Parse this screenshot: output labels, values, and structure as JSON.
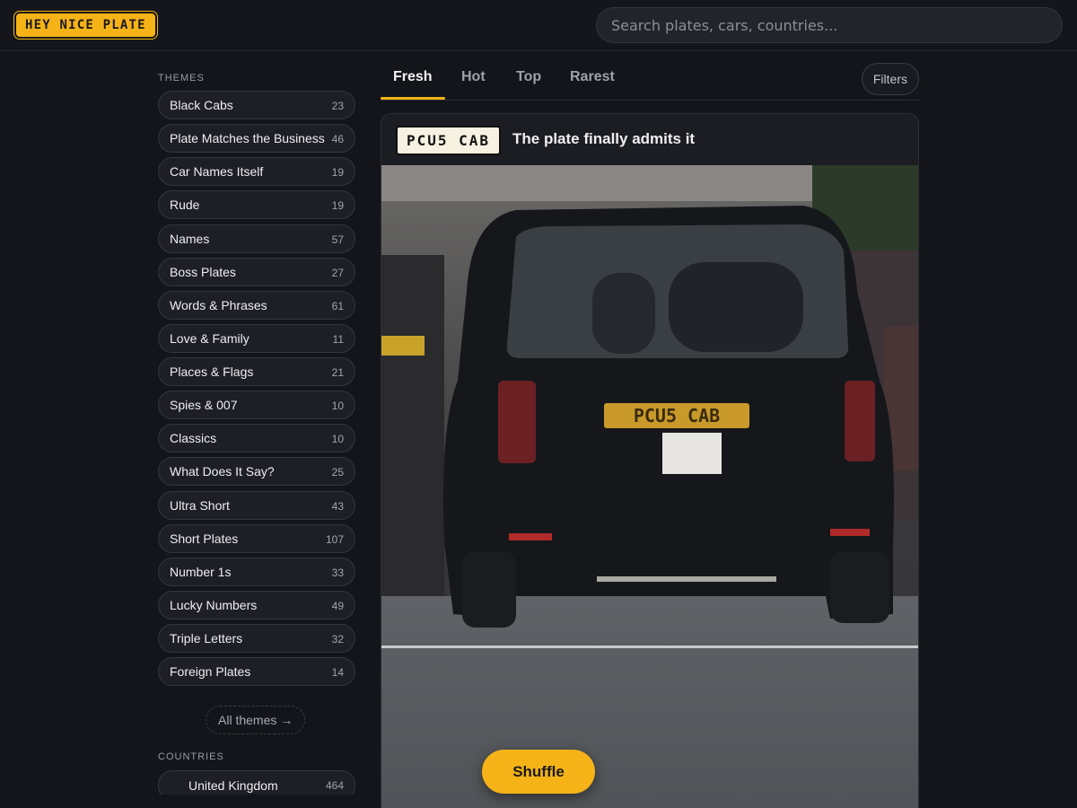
{
  "header": {
    "logo_text": "HEY NICE PLATE",
    "search_placeholder": "Search plates, cars, countries...",
    "accent_color": "#f5b318"
  },
  "sidebar": {
    "themes_title": "THEMES",
    "themes": [
      {
        "label": "Black Cabs",
        "count": "23"
      },
      {
        "label": "Plate Matches the Business",
        "count": "46"
      },
      {
        "label": "Car Names Itself",
        "count": "19"
      },
      {
        "label": "Rude",
        "count": "19"
      },
      {
        "label": "Names",
        "count": "57"
      },
      {
        "label": "Boss Plates",
        "count": "27"
      },
      {
        "label": "Words & Phrases",
        "count": "61"
      },
      {
        "label": "Love & Family",
        "count": "11"
      },
      {
        "label": "Places & Flags",
        "count": "21"
      },
      {
        "label": "Spies & 007",
        "count": "10"
      },
      {
        "label": "Classics",
        "count": "10"
      },
      {
        "label": "What Does It Say?",
        "count": "25"
      },
      {
        "label": "Ultra Short",
        "count": "43"
      },
      {
        "label": "Short Plates",
        "count": "107"
      },
      {
        "label": "Number 1s",
        "count": "33"
      },
      {
        "label": "Lucky Numbers",
        "count": "49"
      },
      {
        "label": "Triple Letters",
        "count": "32"
      },
      {
        "label": "Foreign Plates",
        "count": "14"
      }
    ],
    "all_themes_label": "All themes →",
    "countries_title": "COUNTRIES",
    "countries": [
      {
        "label": "United Kingdom",
        "count": "464",
        "icon": "uk-flag-icon"
      }
    ]
  },
  "tabs": {
    "items": [
      "Fresh",
      "Hot",
      "Top",
      "Rarest"
    ],
    "active": "Fresh",
    "filters_label": "Filters"
  },
  "post": {
    "plate": "PCU5 CAB",
    "title": "The plate finally admits it",
    "photo_plate_text": "PCU5 CAB",
    "photo_icon": "black-taxi-photo"
  },
  "shuffle_label": "Shuffle"
}
